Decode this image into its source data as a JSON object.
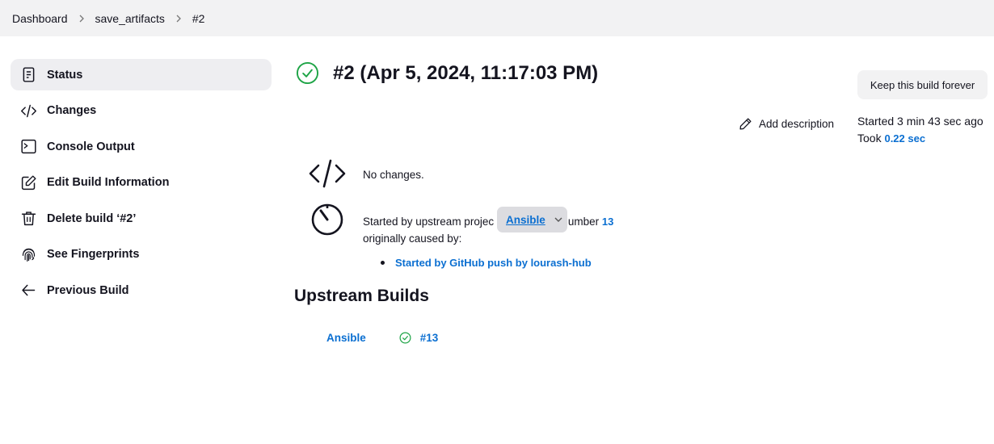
{
  "breadcrumb": {
    "items": [
      "Dashboard",
      "save_artifacts",
      "#2"
    ]
  },
  "sidebar": {
    "items": [
      {
        "label": "Status",
        "icon": "status-document-icon",
        "active": true
      },
      {
        "label": "Changes",
        "icon": "code-icon"
      },
      {
        "label": "Console Output",
        "icon": "terminal-icon"
      },
      {
        "label": "Edit Build Information",
        "icon": "edit-icon"
      },
      {
        "label": "Delete build ‘#2’",
        "icon": "trash-icon"
      },
      {
        "label": "See Fingerprints",
        "icon": "fingerprint-icon"
      },
      {
        "label": "Previous Build",
        "icon": "arrow-left-icon"
      }
    ]
  },
  "build": {
    "title": "#2 (Apr 5, 2024, 11:17:03 PM)",
    "status_icon": "success-check-icon",
    "status_color": "#1ea446",
    "keep_label": "Keep this build forever",
    "add_description_label": "Add description",
    "started_text": "Started 3 min 43 sec ago",
    "took_prefix": "Took ",
    "took_value": "0.22 sec"
  },
  "changes": {
    "icon": "code-icon",
    "text": "No changes."
  },
  "cause": {
    "icon": "timer-icon",
    "prefix": "Started by upstream projec",
    "middle": "d number ",
    "build_number": "13",
    "line2": "originally caused by:",
    "popup_link": "Ansible",
    "bullets": [
      "Started by GitHub push by lourash-hub"
    ]
  },
  "upstream": {
    "title": "Upstream Builds",
    "rows": [
      {
        "project": "Ansible",
        "build": "#13",
        "status_icon": "success-check-icon"
      }
    ]
  },
  "colors": {
    "link": "#0b6fd1",
    "success": "#1ea446",
    "breadcrumb_bg": "#f2f2f3"
  }
}
